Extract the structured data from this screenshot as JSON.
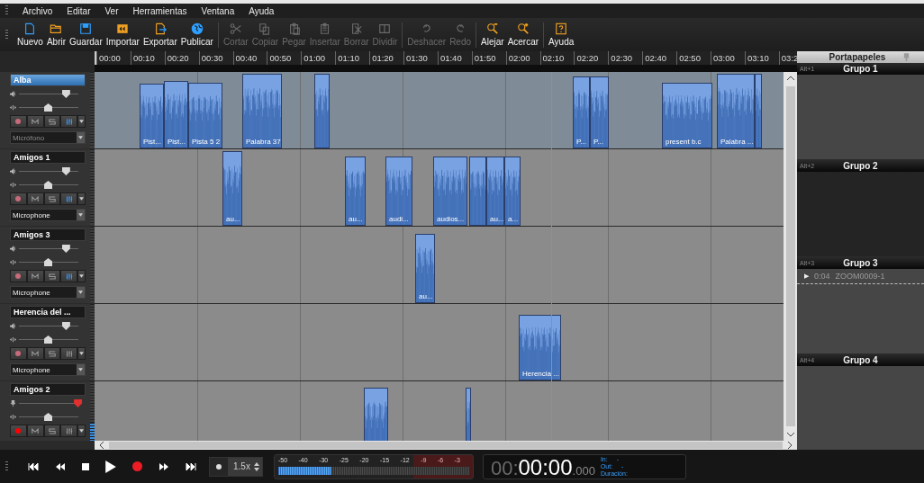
{
  "menu": [
    "Archivo",
    "Editar",
    "Ver",
    "Herramientas",
    "Ventana",
    "Ayuda"
  ],
  "toolbar": [
    {
      "group": [
        {
          "label": "Nuevo",
          "disabled": false
        },
        {
          "label": "Abrir",
          "disabled": false
        },
        {
          "label": "Guardar",
          "disabled": false
        },
        {
          "label": "Importar",
          "disabled": false
        },
        {
          "label": "Exportar",
          "disabled": false
        },
        {
          "label": "Publicar",
          "disabled": false
        }
      ]
    },
    {
      "group": [
        {
          "label": "Cortar",
          "disabled": true
        },
        {
          "label": "Copiar",
          "disabled": true
        },
        {
          "label": "Pegar",
          "disabled": true
        },
        {
          "label": "Insertar",
          "disabled": true
        },
        {
          "label": "Borrar",
          "disabled": true
        },
        {
          "label": "Dividir",
          "disabled": true
        }
      ]
    },
    {
      "group": [
        {
          "label": "Deshacer",
          "disabled": true
        },
        {
          "label": "Redo",
          "disabled": true
        }
      ]
    },
    {
      "group": [
        {
          "label": "Alejar",
          "disabled": false
        },
        {
          "label": "Acercar",
          "disabled": false
        }
      ]
    },
    {
      "group": [
        {
          "label": "Ayuda",
          "disabled": false
        }
      ]
    }
  ],
  "ruler": [
    "00:00",
    "00:10",
    "00:20",
    "00:30",
    "00:40",
    "00:50",
    "01:00",
    "01:10",
    "01:20",
    "01:30",
    "01:40",
    "01:50",
    "02:00",
    "02:10",
    "02:20",
    "02:30",
    "02:40",
    "02:50",
    "03:00",
    "03:10",
    "03:2"
  ],
  "tracks": [
    {
      "name": "Alba",
      "selected": true,
      "volume": {
        "level": 0.8,
        "peak": false
      },
      "pan": {
        "level": 0.5
      },
      "armed": false,
      "mixer_on": true,
      "input": {
        "value": "Micrófono",
        "disabled": true
      },
      "clips": [
        {
          "label": "Pist..."
        },
        {
          "label": "Pist..."
        },
        {
          "label": "Pista 5 2"
        },
        {
          "label": "Palabra 37"
        },
        {
          "label": "P..."
        },
        {
          "label": "P..."
        },
        {
          "label": "present b.c"
        },
        {
          "label": "Palabra ..."
        }
      ]
    },
    {
      "name": "Amigos 1",
      "selected": false,
      "volume": {
        "level": 0.8,
        "peak": false
      },
      "pan": {
        "level": 0.5
      },
      "armed": false,
      "mixer_on": true,
      "input": {
        "value": "Microphone",
        "disabled": false
      },
      "clips": [
        {
          "label": "au..."
        },
        {
          "label": "au..."
        },
        {
          "label": "audi..."
        },
        {
          "label": "audios..."
        },
        {
          "label": "au..."
        },
        {
          "label": "a..."
        }
      ]
    },
    {
      "name": "Amigos 3",
      "selected": false,
      "volume": {
        "level": 0.8,
        "peak": false
      },
      "pan": {
        "level": 0.5
      },
      "armed": false,
      "mixer_on": true,
      "input": {
        "value": "Microphone",
        "disabled": false
      },
      "clips": [
        {
          "label": "au..."
        }
      ]
    },
    {
      "name": "Herencia del ...",
      "selected": false,
      "volume": {
        "level": 0.8,
        "peak": false
      },
      "pan": {
        "level": 0.5
      },
      "armed": false,
      "mixer_on": false,
      "input": {
        "value": "Microphone",
        "disabled": false
      },
      "clips": [
        {
          "label": "Herencia ..."
        }
      ]
    },
    {
      "name": "Amigos 2",
      "selected": false,
      "volume": {
        "level": 1,
        "peak": true
      },
      "pan": {
        "level": 0.5
      },
      "armed": true,
      "mixer_on": false,
      "meter": {
        "level": 0.45
      }
    }
  ],
  "clipboard": {
    "title": "Portapapeles",
    "groups": [
      {
        "shortcut": "Alt+1",
        "name": "Grupo 1",
        "selected": false
      },
      {
        "shortcut": "Alt+2",
        "name": "Grupo 2",
        "selected": true
      },
      {
        "shortcut": "Alt+3",
        "name": "Grupo 3",
        "selected": false,
        "items": [
          {
            "play": "▶",
            "duration": "0:04",
            "name": "ZOOM0009-1"
          }
        ]
      },
      {
        "shortcut": "Alt+4",
        "name": "Grupo 4",
        "selected": false
      }
    ]
  },
  "transport": {
    "speed": "1.5x",
    "meter": {
      "scale": [
        "-50",
        "-40",
        "-30",
        "-25",
        "-20",
        "-15",
        "-12",
        "-9",
        "-6",
        "-3"
      ],
      "level": 0.28
    },
    "time": {
      "hours": "00:",
      "main": "00:00",
      "ms": ".000",
      "in_label": "In:",
      "in_value": "-",
      "out_label": "Out:",
      "out_value": "-",
      "duration_label": "Duración:"
    }
  }
}
